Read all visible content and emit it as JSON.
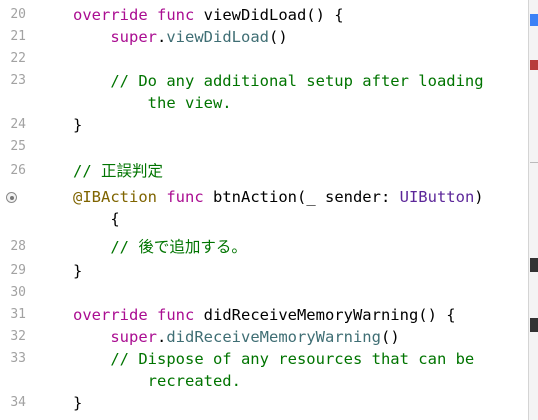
{
  "lines": [
    {
      "num": "20",
      "parts": [
        [
          "kw",
          "override"
        ],
        [
          "pl",
          " "
        ],
        [
          "kw",
          "func"
        ],
        [
          "pl",
          " viewDidLoad() {"
        ]
      ]
    },
    {
      "num": "21",
      "parts": [
        [
          "pl",
          "    "
        ],
        [
          "kw",
          "super"
        ],
        [
          "pl",
          "."
        ],
        [
          "fn",
          "viewDidLoad"
        ],
        [
          "pl",
          "()"
        ]
      ]
    },
    {
      "num": "22",
      "parts": []
    },
    {
      "num": "23",
      "parts": [
        [
          "cm",
          "    // Do any additional setup after loading"
        ]
      ]
    },
    {
      "num": "",
      "parts": [
        [
          "cm",
          "        the view."
        ]
      ]
    },
    {
      "num": "24",
      "parts": [
        [
          "pl",
          "}"
        ]
      ]
    },
    {
      "num": "25",
      "parts": []
    },
    {
      "num": "26",
      "parts": [
        [
          "cm",
          "// 正誤判定"
        ]
      ]
    },
    {
      "num": "",
      "breakpoint": true,
      "parts": [
        [
          "at",
          "@IBAction"
        ],
        [
          "pl",
          " "
        ],
        [
          "kw",
          "func"
        ],
        [
          "pl",
          " btnAction(_ sender: "
        ],
        [
          "ty",
          "UIButton"
        ],
        [
          "pl",
          ")"
        ]
      ]
    },
    {
      "num": "",
      "parts": [
        [
          "pl",
          "    {"
        ]
      ]
    },
    {
      "num": "28",
      "parts": [
        [
          "cm",
          "    // 後で追加する。"
        ]
      ]
    },
    {
      "num": "29",
      "parts": [
        [
          "pl",
          "}"
        ]
      ]
    },
    {
      "num": "30",
      "parts": []
    },
    {
      "num": "31",
      "parts": [
        [
          "kw",
          "override"
        ],
        [
          "pl",
          " "
        ],
        [
          "kw",
          "func"
        ],
        [
          "pl",
          " didReceiveMemoryWarning() {"
        ]
      ]
    },
    {
      "num": "32",
      "parts": [
        [
          "pl",
          "    "
        ],
        [
          "kw",
          "super"
        ],
        [
          "pl",
          "."
        ],
        [
          "fn",
          "didReceiveMemoryWarning"
        ],
        [
          "pl",
          "()"
        ]
      ]
    },
    {
      "num": "33",
      "parts": [
        [
          "cm",
          "    // Dispose of any resources that can be"
        ]
      ]
    },
    {
      "num": "",
      "parts": [
        [
          "cm",
          "        recreated."
        ]
      ]
    },
    {
      "num": "34",
      "parts": [
        [
          "pl",
          "}"
        ]
      ]
    }
  ],
  "colors": {
    "keyword": "#aa0d91",
    "function": "#3f6e74",
    "type": "#5c2699",
    "comment": "#007400",
    "attribute": "#7f6400",
    "line_number": "#a2a2a2"
  },
  "icons": {
    "breakpoint": "breakpoint-icon"
  }
}
